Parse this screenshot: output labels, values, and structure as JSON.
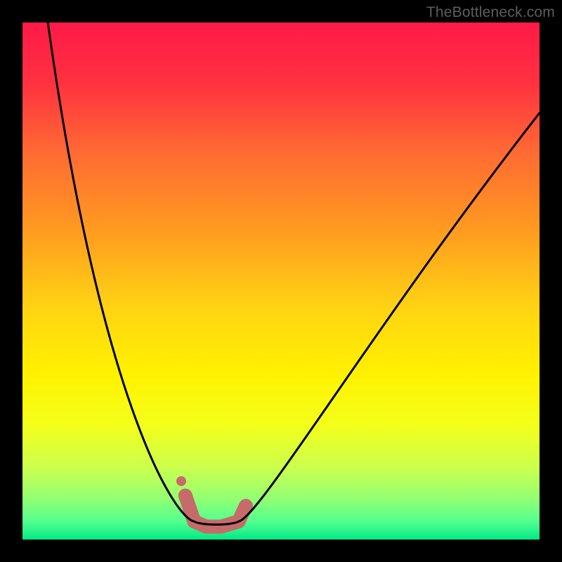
{
  "watermark": "TheBottleneck.com",
  "gradient": {
    "stops": [
      {
        "offset": 0.0,
        "color": "#ff1a48"
      },
      {
        "offset": 0.12,
        "color": "#ff3240"
      },
      {
        "offset": 0.25,
        "color": "#ff6a33"
      },
      {
        "offset": 0.4,
        "color": "#ff9a20"
      },
      {
        "offset": 0.55,
        "color": "#ffd313"
      },
      {
        "offset": 0.68,
        "color": "#fff200"
      },
      {
        "offset": 0.78,
        "color": "#f3ff1b"
      },
      {
        "offset": 0.86,
        "color": "#ccff4d"
      },
      {
        "offset": 0.92,
        "color": "#94ff72"
      },
      {
        "offset": 0.965,
        "color": "#54ff8f"
      },
      {
        "offset": 1.0,
        "color": "#00e985"
      }
    ]
  },
  "curve": {
    "stroke": "#000000",
    "stroke_width": 3,
    "blob_color": "#c76a6a",
    "blob_stroke_width": 20,
    "left_point": {
      "x": 0.045,
      "y": -0.03
    },
    "apex_left": {
      "x": 0.332,
      "y": 0.965
    },
    "apex_right": {
      "x": 0.418,
      "y": 0.965
    },
    "right_point": {
      "x": 1.0,
      "y": 0.175
    }
  },
  "chart_data": {
    "type": "line",
    "title": "",
    "xlabel": "",
    "ylabel": "",
    "xlim": [
      0,
      1
    ],
    "ylim": [
      0,
      1
    ],
    "note": "Axes unlabeled in source; x and y normalized 0–1 from plot edges; y measured from top (0) to bottom (1).",
    "series": [
      {
        "name": "curve",
        "x": [
          0.045,
          0.08,
          0.12,
          0.16,
          0.2,
          0.24,
          0.28,
          0.3,
          0.332,
          0.36,
          0.39,
          0.418,
          0.44,
          0.48,
          0.55,
          0.62,
          0.7,
          0.8,
          0.9,
          1.0
        ],
        "y": [
          -0.03,
          0.12,
          0.28,
          0.44,
          0.59,
          0.73,
          0.86,
          0.91,
          0.965,
          0.97,
          0.97,
          0.965,
          0.93,
          0.86,
          0.74,
          0.63,
          0.52,
          0.4,
          0.28,
          0.175
        ]
      }
    ],
    "highlight": {
      "name": "bottom-blob",
      "x": [
        0.315,
        0.332,
        0.355,
        0.385,
        0.418,
        0.432
      ],
      "y": [
        0.915,
        0.965,
        0.975,
        0.975,
        0.965,
        0.935
      ]
    }
  }
}
